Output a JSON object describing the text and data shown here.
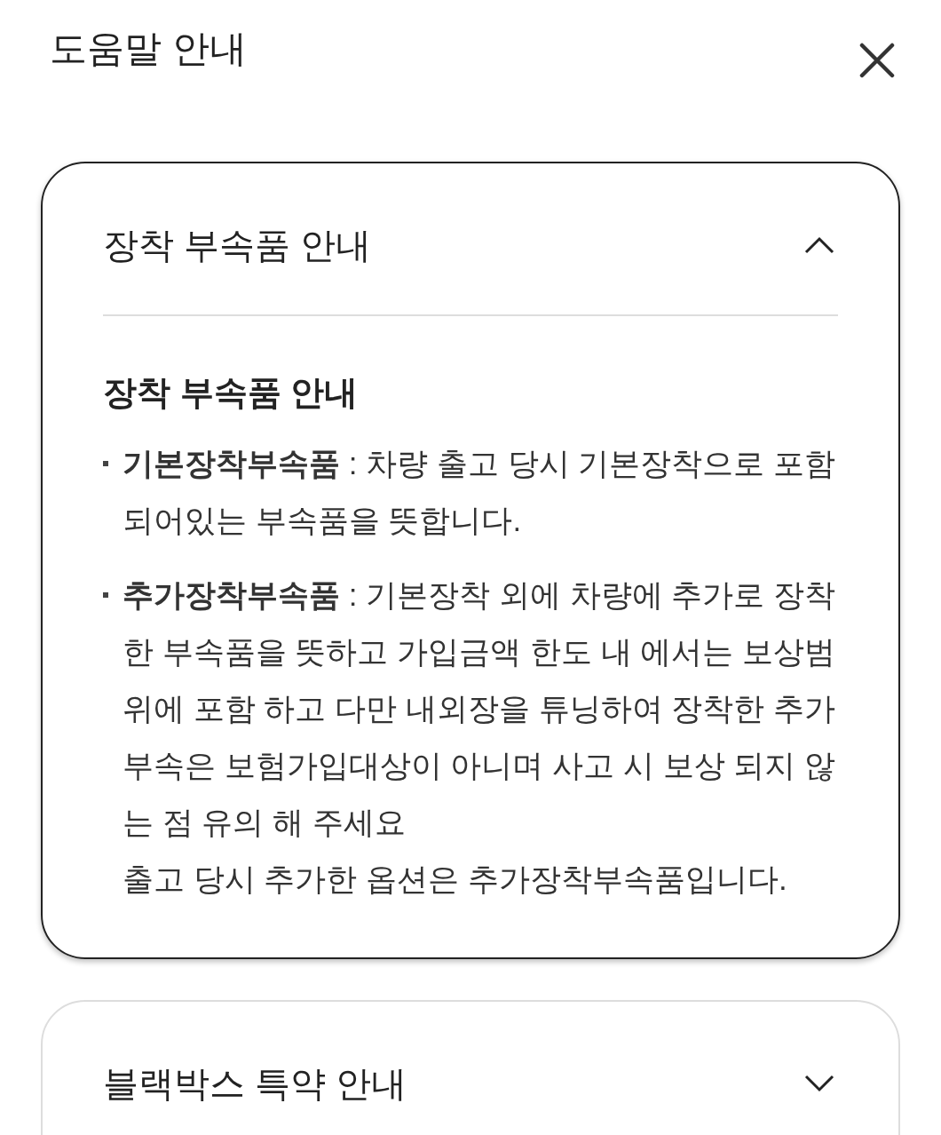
{
  "header": {
    "title": "도움말 안내"
  },
  "sections": [
    {
      "title": "장착 부속품 안내",
      "expanded": true,
      "content": {
        "heading": "장착 부속품 안내",
        "bullets": [
          {
            "text": "**기본장착부속품** : 차량 출고 당시 기본장착으로 포함되어있는 부속품을 뜻합니다."
          },
          {
            "text": "**추가장착부속품** : 기본장착 외에 차량에 추가로 장착한 부속품을 뜻하고 가입금액 한도 내 에서는 보상범위에 포함 하고 다만 내외장을 튜닝하여 장착한 추가부속은 보험가입대상이 아니며 사고 시 보상 되지 않는 점 유의 해 주세요",
            "note": "출고 당시 추가한 옵션은 추가장착부속품입니다."
          }
        ]
      }
    },
    {
      "title": "블랙박스 특약 안내",
      "expanded": false
    }
  ]
}
